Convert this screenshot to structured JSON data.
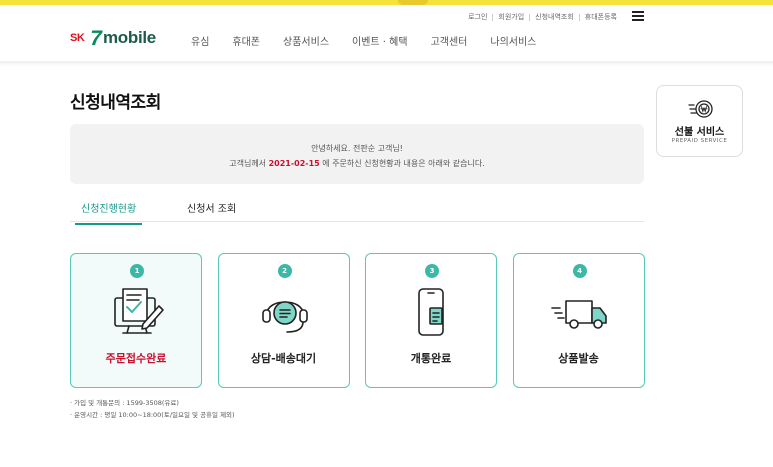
{
  "util_nav": [
    "로그인",
    "회원가입",
    "신청내역조회",
    "휴대폰등록"
  ],
  "logo": {
    "sk": "SK",
    "seven": "7",
    "mobile": "mobile"
  },
  "gnb": [
    "유심",
    "휴대폰",
    "상품서비스",
    "이벤트 · 혜택",
    "고객센터",
    "나의서비스"
  ],
  "page_title": "신청내역조회",
  "greeting": {
    "line1": "안녕하세요. 전판순 고객님!",
    "line2_prefix": "고객님께서 ",
    "date": "2021-02-15",
    "line2_suffix": " 에 주문하신 신청현황과 내용은 아래와 같습니다."
  },
  "tabs": {
    "active": "신청진행현황",
    "inactive": "신청서 조회"
  },
  "steps": [
    {
      "num": "1",
      "label": "주문접수완료",
      "icon": "order-document-icon"
    },
    {
      "num": "2",
      "label": "상담-배송대기",
      "icon": "headset-icon"
    },
    {
      "num": "3",
      "label": "개통완료",
      "icon": "phone-sim-icon"
    },
    {
      "num": "4",
      "label": "상품발송",
      "icon": "delivery-truck-icon"
    }
  ],
  "notes": [
    "· 가입 및 개통문의 : 1599-3508(유료)",
    "· 운영시간 : 평일 10:00~18:00(토/일요일 및 공휴일 제외)"
  ],
  "prepaid": {
    "title": "선불 서비스",
    "sub": "PREPAID SERVICE",
    "icon": "prepaid-won-icon"
  },
  "colors": {
    "accent": "#17998a",
    "step_border": "#59c7b9",
    "highlight_red": "#c8102e",
    "top_bar": "#f6e23a"
  }
}
